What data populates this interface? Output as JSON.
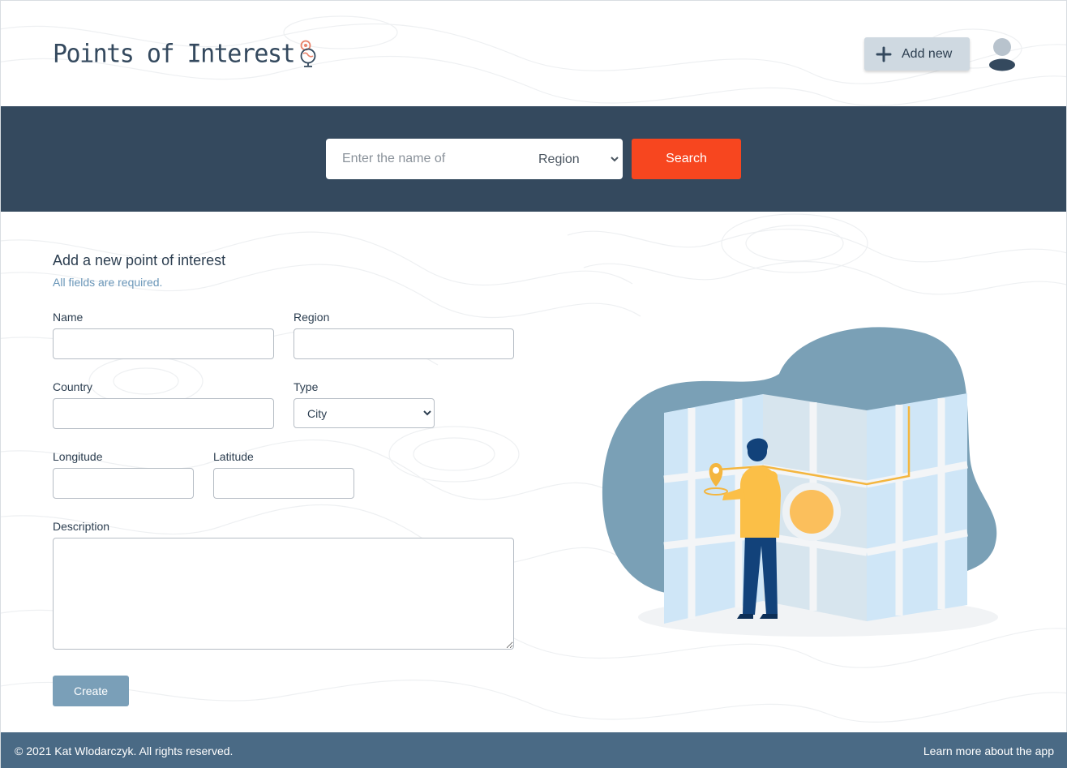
{
  "header": {
    "logo_text": "Points of Interest",
    "add_new_label": "Add new"
  },
  "search": {
    "placeholder": "Enter the name of",
    "region_selected": "Region",
    "button_label": "Search"
  },
  "form": {
    "title": "Add a new point of interest",
    "subtitle": "All fields are required.",
    "name_label": "Name",
    "region_label": "Region",
    "country_label": "Country",
    "type_label": "Type",
    "type_selected": "City",
    "longitude_label": "Longitude",
    "latitude_label": "Latitude",
    "description_label": "Description",
    "create_label": "Create"
  },
  "footer": {
    "copyright": "© 2021 Kat Wlodarczyk. All rights reserved.",
    "learn_more": "Learn more about the app"
  },
  "colors": {
    "navy": "#34495e",
    "search_button": "#f7461f",
    "create_button": "#7a9fb8",
    "footer": "#4a6a85",
    "add_new_bg": "#cfd9e1"
  },
  "icons": [
    "globe-pin-icon",
    "plus-icon",
    "user-avatar-icon",
    "chevron-down-icon"
  ]
}
